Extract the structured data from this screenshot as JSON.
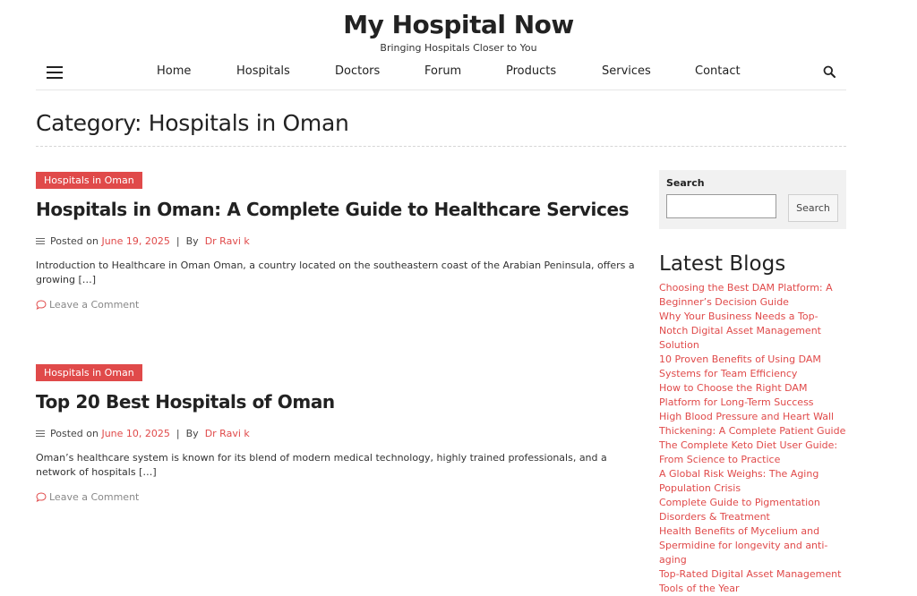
{
  "site": {
    "title": "My Hospital Now",
    "tagline": "Bringing Hospitals Closer to You"
  },
  "nav": {
    "items": [
      {
        "label": "Home"
      },
      {
        "label": "Hospitals"
      },
      {
        "label": "Doctors"
      },
      {
        "label": "Forum"
      },
      {
        "label": "Products"
      },
      {
        "label": "Services"
      },
      {
        "label": "Contact"
      }
    ]
  },
  "page": {
    "category_title": "Category: Hospitals in Oman"
  },
  "posts": [
    {
      "category": "Hospitals in Oman",
      "title": "Hospitals in Oman: A Complete Guide to Healthcare Services",
      "posted_prefix": "Posted on",
      "date": "June 19, 2025",
      "sep": "|",
      "by": "By",
      "author": "Dr Ravi k",
      "excerpt": "Introduction to Healthcare in Oman Oman, a country located on the southeastern coast of the Arabian Peninsula, offers a growing […]",
      "comment_label": "Leave a Comment"
    },
    {
      "category": "Hospitals in Oman",
      "title": "Top 20 Best Hospitals of Oman",
      "posted_prefix": "Posted on",
      "date": "June 10, 2025",
      "sep": "|",
      "by": "By",
      "author": "Dr Ravi k",
      "excerpt": "Oman’s healthcare system is known for its blend of modern medical technology, highly trained professionals, and a network of hospitals […]",
      "comment_label": "Leave a Comment"
    }
  ],
  "sidebar": {
    "search": {
      "label": "Search",
      "placeholder": "",
      "button_label": "Search"
    },
    "latest_title": "Latest Blogs",
    "latest": [
      {
        "label": "Choosing the Best DAM Platform: A Beginner’s Decision Guide"
      },
      {
        "label": "Why Your Business Needs a Top-Notch Digital Asset Management Solution"
      },
      {
        "label": "10 Proven Benefits of Using DAM Systems for Team Efficiency"
      },
      {
        "label": "How to Choose the Right DAM Platform for Long-Term Success"
      },
      {
        "label": "High Blood Pressure and Heart Wall Thickening: A Complete Patient Guide"
      },
      {
        "label": "The Complete Keto Diet User Guide: From Science to Practice"
      },
      {
        "label": "A Global Risk Weighs: The Aging Population Crisis"
      },
      {
        "label": "Complete Guide to Pigmentation Disorders & Treatment"
      },
      {
        "label": "Health Benefits of Mycelium and Spermidine for longevity and anti-aging"
      },
      {
        "label": "Top-Rated Digital Asset Management Tools of the Year"
      }
    ]
  },
  "colors": {
    "accent": "#e04a4a",
    "text": "#222222",
    "muted": "#888888"
  },
  "icons": {
    "menu": "hamburger-menu-icon",
    "search": "search-icon",
    "meta": "list-lines-icon",
    "comment": "speech-bubble-icon"
  }
}
